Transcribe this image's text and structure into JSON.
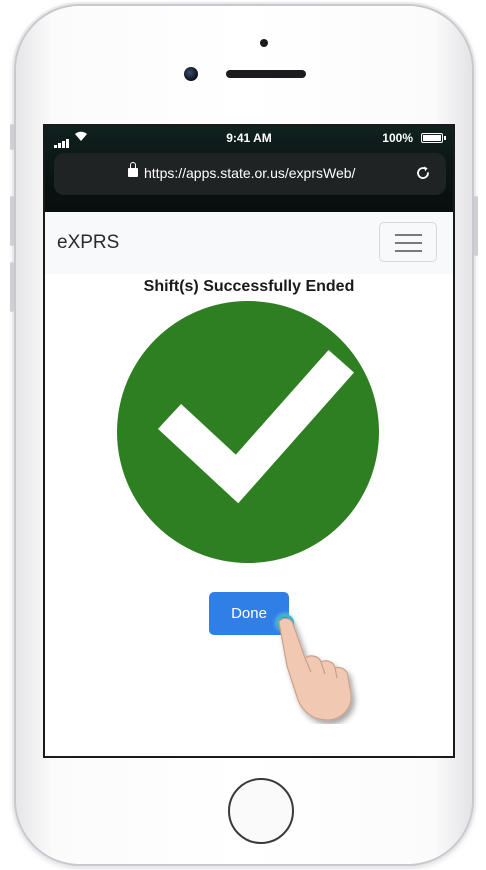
{
  "status_bar": {
    "time": "9:41 AM",
    "battery": "100%"
  },
  "browser": {
    "url": "https://apps.state.or.us/exprsWeb/"
  },
  "navbar": {
    "brand": "eXPRS"
  },
  "content": {
    "title": "Shift(s) Successfully Ended",
    "done_label": "Done"
  },
  "colors": {
    "success_green": "#2e7e22",
    "primary_blue": "#2f7fe6",
    "navbar_bg": "#f8f9fa"
  },
  "icons": {
    "success": "checkmark-icon",
    "menu": "hamburger-menu-icon",
    "lock": "lock-icon",
    "reload": "reload-icon"
  }
}
